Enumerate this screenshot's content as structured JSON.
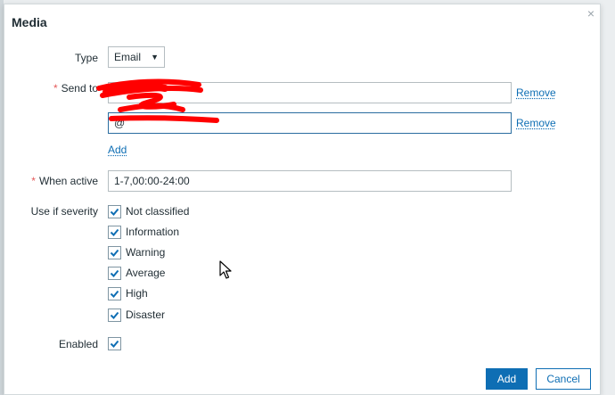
{
  "dialog": {
    "title": "Media",
    "close_glyph": "×"
  },
  "form": {
    "type_label": "Type",
    "type_value": "Email",
    "send_to_label": "Send to",
    "send_to_values": [
      "",
      "@"
    ],
    "remove_label": "Remove",
    "add_link_label": "Add",
    "when_active_label": "When active",
    "when_active_value": "1-7,00:00-24:00",
    "severity_label": "Use if severity",
    "severities": [
      {
        "label": "Not classified",
        "checked": true
      },
      {
        "label": "Information",
        "checked": true
      },
      {
        "label": "Warning",
        "checked": true
      },
      {
        "label": "Average",
        "checked": true
      },
      {
        "label": "High",
        "checked": true
      },
      {
        "label": "Disaster",
        "checked": true
      }
    ],
    "enabled_label": "Enabled",
    "enabled_checked": true,
    "required_mark": "*"
  },
  "buttons": {
    "add_label": "Add",
    "cancel_label": "Cancel"
  },
  "colors": {
    "accent": "#0e6eb4",
    "required": "#e45959",
    "redaction": "#ff0000"
  },
  "icons": {
    "close": "close-icon",
    "caret": "chevron-down-icon",
    "checkmark": "checkmark-icon",
    "pointer": "mouse-pointer-icon"
  }
}
